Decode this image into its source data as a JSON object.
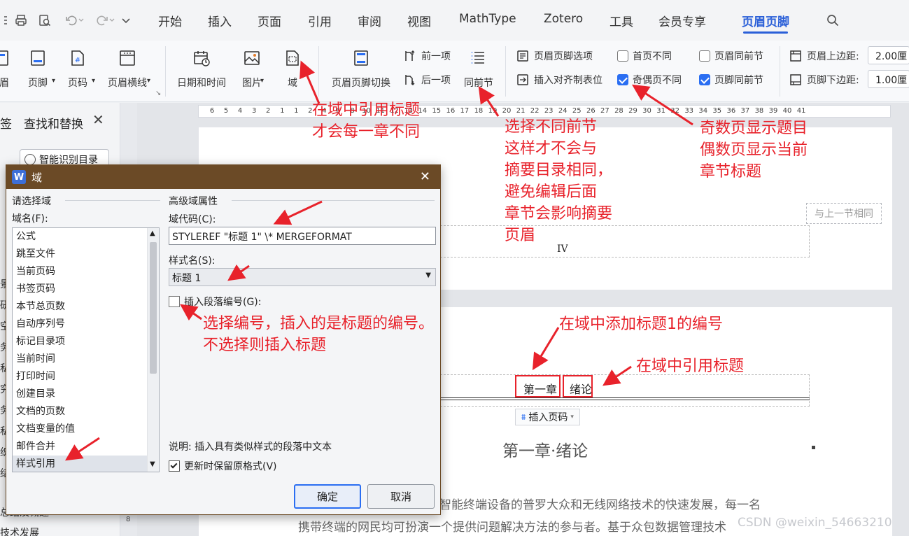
{
  "menubar": {
    "tabs": [
      "开始",
      "插入",
      "页面",
      "引用",
      "审阅",
      "视图",
      "MathType",
      "Zotero",
      "工具",
      "会员专享",
      "页眉页脚"
    ],
    "active_tab": "页眉页脚"
  },
  "ribbon": {
    "header_label": "眉",
    "footer_label": "页脚",
    "page_number_label": "页码",
    "header_line_label": "页眉横线",
    "datetime_label": "日期和时间",
    "picture_label": "图片",
    "field_label": "域",
    "switch_label": "页眉页脚切换",
    "previous_label": "前一项",
    "next_label": "后一项",
    "same_as_previous_label": "同前节",
    "options_label": "页眉页脚选项",
    "insert_align_tab_label": "插入对齐制表位",
    "different_first_page": {
      "label": "首页不同",
      "checked": false
    },
    "different_odd_even": {
      "label": "奇偶页不同",
      "checked": true
    },
    "header_same_as_previous": {
      "label": "页眉同前节",
      "checked": false
    },
    "footer_same_as_previous": {
      "label": "页脚同前节",
      "checked": true
    },
    "header_top_margin_label": "页眉上边距:",
    "header_top_margin_value": "2.00厘",
    "footer_bottom_margin_label": "页脚下边距:",
    "footer_bottom_margin_value": "1.00厘"
  },
  "left_pane": {
    "tab_partial": "签",
    "find_replace": "查找和替换",
    "smart_toc_button": "智能识别目录",
    "cut_off_chars": [
      "景",
      "研",
      "空",
      "务",
      "私",
      "究",
      "务",
      "私",
      "织",
      "结"
    ],
    "bottom_items": [
      "总结及概述",
      "技术发展"
    ]
  },
  "ruler": {
    "numbers": [
      "6",
      "5",
      "4",
      "3",
      "2",
      "1",
      "1",
      "2",
      "4",
      "6",
      "8",
      "10",
      "11",
      "12",
      "13",
      "14",
      "15",
      "16",
      "17",
      "18",
      "19",
      "20",
      "21",
      "22",
      "23",
      "24",
      "25",
      "26",
      "27",
      "28",
      "29",
      "30",
      "31",
      "32",
      "33",
      "34",
      "35",
      "36",
      "37",
      "38",
      "39",
      "40",
      "41"
    ]
  },
  "document": {
    "same_as_previous_tag": "与上一节相同",
    "page_roman_number": "IV",
    "header_field_number": "第一章",
    "header_field_title": "绪论",
    "insert_page_number_button": "插入页码",
    "chapter_heading": "第一章·绪论",
    "body_line_1": "智能终端设备的普罗大众和无线网络技术的快速发展，每一名",
    "body_line_2": "携带终端的网民均可扮演一个提供问题解决方法的参与者。基于众包数据管理技术"
  },
  "dialog": {
    "title": "域",
    "choose_field_group": "请选择域",
    "field_name_label": "域名(F):",
    "field_names": [
      "公式",
      "跳至文件",
      "当前页码",
      "书签页码",
      "本节总页数",
      "自动序列号",
      "标记目录项",
      "当前时间",
      "打印时间",
      "创建目录",
      "文档的页数",
      "文档变量的值",
      "邮件合并",
      "样式引用"
    ],
    "selected_field": "样式引用",
    "advanced_group": "高级域属性",
    "field_code_label": "域代码(C):",
    "field_code_value": "STYLEREF \"标题 1\" \\* MERGEFORMAT",
    "style_name_label": "样式名(S):",
    "style_name_value": "标题 1",
    "insert_para_number_label": "插入段落编号(G):",
    "insert_para_number_checked": false,
    "description": "说明: 插入具有类似样式的段落中文本",
    "preserve_format_label": "更新时保留原格式(V)",
    "preserve_format_checked": true,
    "ok_label": "确定",
    "cancel_label": "取消"
  },
  "annotations": {
    "field_ref_title": [
      "在域中引用标题",
      "才会每一章不同"
    ],
    "same_as_prev_note": [
      "选择不同前节",
      "这样才不会与",
      "摘要目录相同，",
      "避免编辑后面",
      "章节会影响摘要",
      "页眉"
    ],
    "odd_even_note": [
      "奇数页显示题目",
      "偶数页显示当前",
      "章节标题"
    ],
    "para_number_note": [
      "选择编号，插入的是标题的编号。",
      "不选择则插入标题"
    ],
    "add_number_note": "在域中添加标题1的编号",
    "ref_title_note": "在域中引用标题",
    "accent_color": "#e8222b"
  },
  "watermark": "CSDN @weixin_54663210"
}
